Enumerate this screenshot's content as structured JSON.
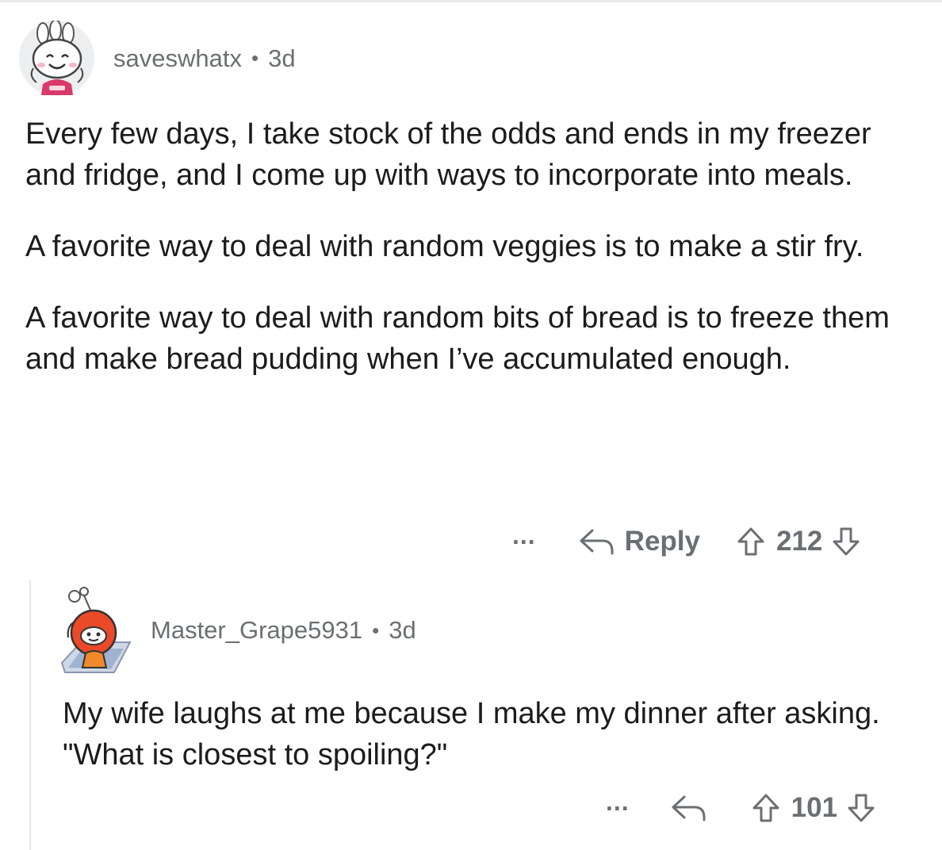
{
  "comments": [
    {
      "username": "saveswhatx",
      "separator": "•",
      "age": "3d",
      "paragraphs": [
        "Every few days, I take stock of the odds and ends in my freezer and fridge, and I come up with ways to incorporate into meals.",
        "A favorite way to deal with random veggies is to make a stir fry.",
        "A favorite way to deal with random bits of bread is to freeze them and make bread pudding when I’ve accumulated enough."
      ],
      "actions": {
        "more": "...",
        "reply_label": "Reply",
        "score": "212"
      }
    },
    {
      "username": "Master_Grape5931",
      "separator": "•",
      "age": "3d",
      "paragraphs": [
        "My wife laughs at me because I make my dinner after asking. \"What is closest to spoiling?\""
      ],
      "actions": {
        "more": "...",
        "score": "101"
      }
    }
  ],
  "icons": {
    "reply": "reply-arrow-icon",
    "upvote": "upvote-arrow-icon",
    "downvote": "downvote-arrow-icon",
    "more": "more-options-icon"
  },
  "colors": {
    "meta_text": "#6b6f73",
    "body_text": "#1c1c1c",
    "thread_line": "#e4e4e4",
    "avatar_bg": "#eceef0",
    "snoo_orange": "#ea4a2a"
  }
}
